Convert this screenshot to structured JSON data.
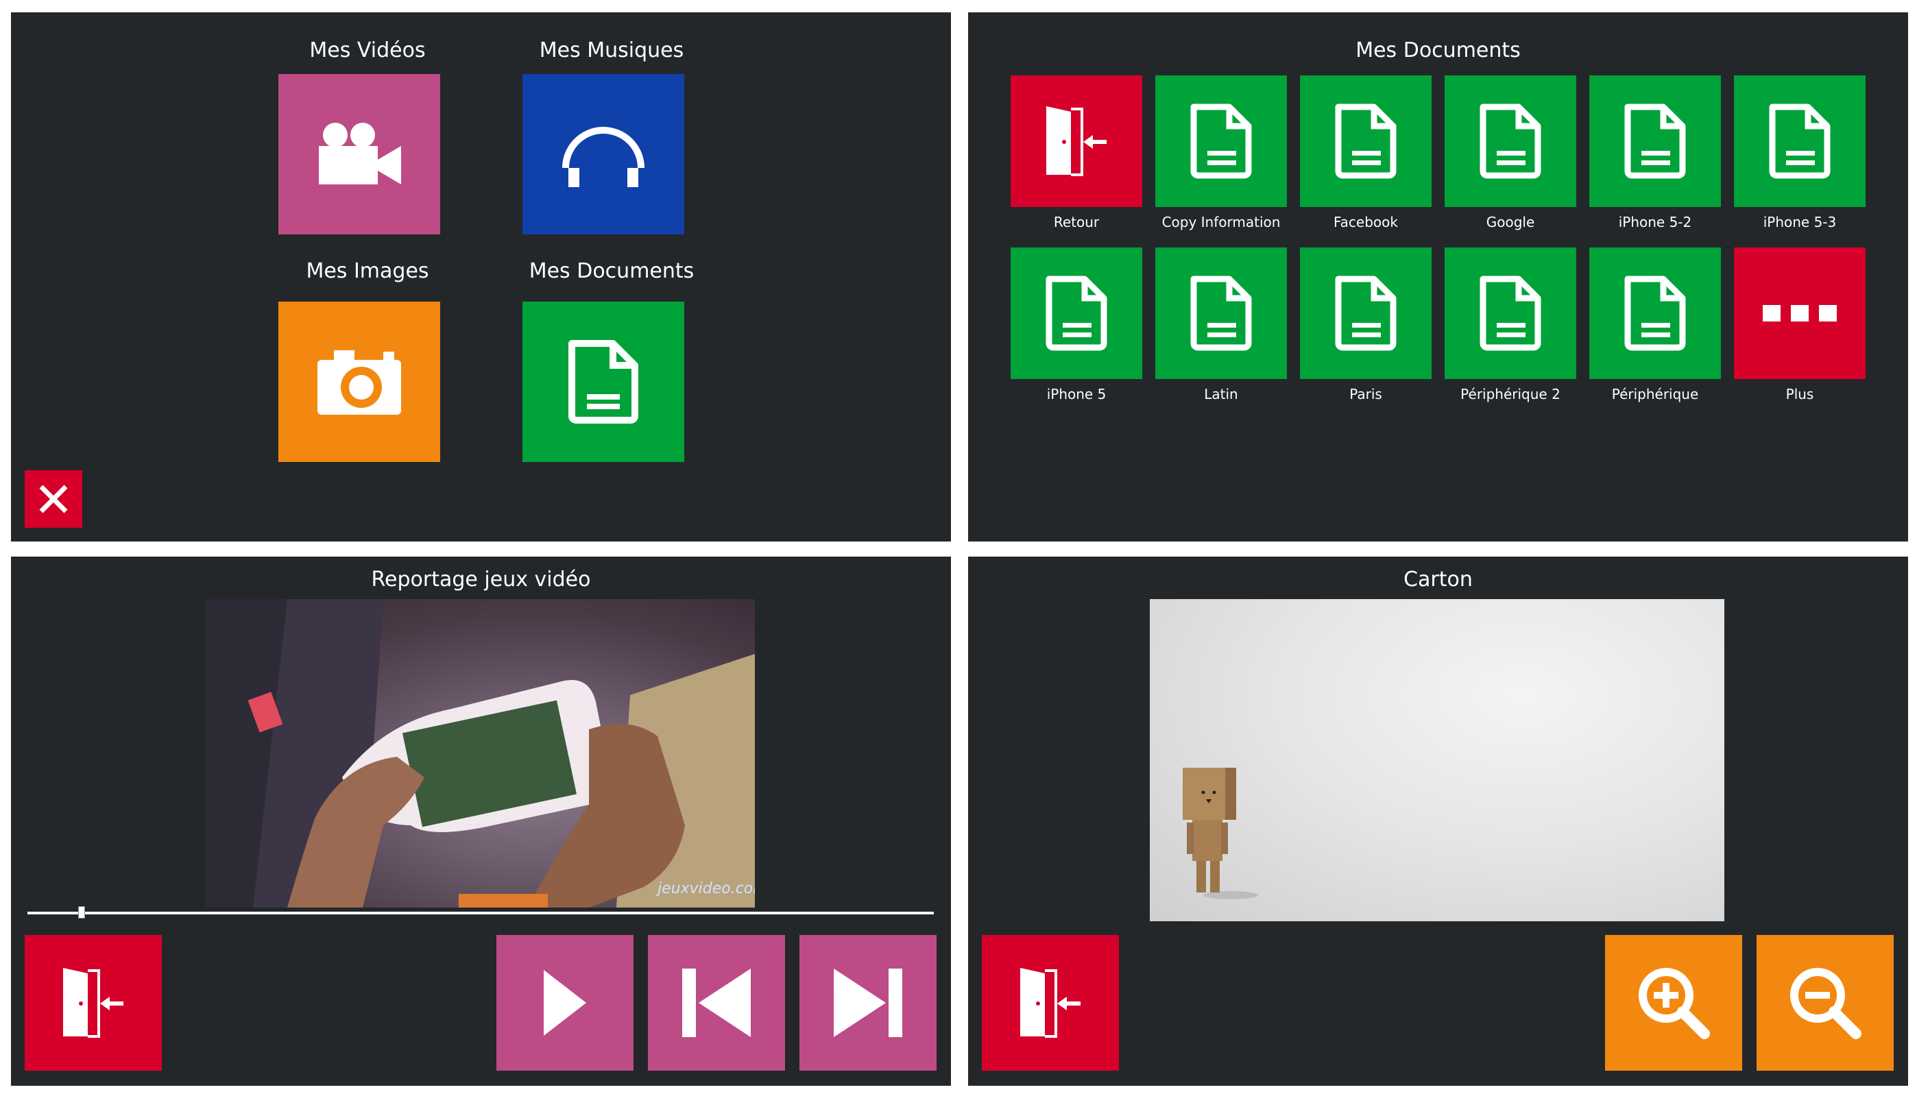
{
  "home": {
    "tiles": [
      {
        "label": "Mes Vidéos",
        "icon": "video-camera-icon",
        "color": "#bd4b86"
      },
      {
        "label": "Mes Musiques",
        "icon": "headphones-icon",
        "color": "#1040aa"
      },
      {
        "label": "Mes Images",
        "icon": "camera-icon",
        "color": "#f38810"
      },
      {
        "label": "Mes Documents",
        "icon": "document-icon",
        "color": "#00a23a"
      }
    ],
    "close_icon": "close-icon"
  },
  "documents": {
    "title": "Mes Documents",
    "items": [
      {
        "label": "Retour",
        "icon": "exit-door-icon",
        "color": "#d6002a"
      },
      {
        "label": "Copy Information",
        "icon": "document-icon",
        "color": "#00a23a"
      },
      {
        "label": "Facebook",
        "icon": "document-icon",
        "color": "#00a23a"
      },
      {
        "label": "Google",
        "icon": "document-icon",
        "color": "#00a23a"
      },
      {
        "label": "iPhone 5-2",
        "icon": "document-icon",
        "color": "#00a23a"
      },
      {
        "label": "iPhone 5-3",
        "icon": "document-icon",
        "color": "#00a23a"
      },
      {
        "label": "iPhone 5",
        "icon": "document-icon",
        "color": "#00a23a"
      },
      {
        "label": "Latin",
        "icon": "document-icon",
        "color": "#00a23a"
      },
      {
        "label": "Paris",
        "icon": "document-icon",
        "color": "#00a23a"
      },
      {
        "label": "Périphérique 2",
        "icon": "document-icon",
        "color": "#00a23a"
      },
      {
        "label": "Périphérique",
        "icon": "document-icon",
        "color": "#00a23a"
      },
      {
        "label": "Plus",
        "icon": "more-dots-icon",
        "color": "#d6002a"
      }
    ]
  },
  "video_player": {
    "title": "Reportage jeux vidéo",
    "watermark": "jeuxvideo.com",
    "progress": 0.06,
    "controls": [
      {
        "name": "exit",
        "icon": "exit-door-icon",
        "color": "#d6002a"
      },
      {
        "name": "play",
        "icon": "play-icon",
        "color": "#bd4b86"
      },
      {
        "name": "previous",
        "icon": "skip-previous-icon",
        "color": "#bd4b86"
      },
      {
        "name": "next",
        "icon": "skip-next-icon",
        "color": "#bd4b86"
      }
    ]
  },
  "image_viewer": {
    "title": "Carton",
    "controls": [
      {
        "name": "exit",
        "icon": "exit-door-icon",
        "color": "#d6002a"
      },
      {
        "name": "zoom-in",
        "icon": "zoom-in-icon",
        "color": "#f38810"
      },
      {
        "name": "zoom-out",
        "icon": "zoom-out-icon",
        "color": "#f38810"
      }
    ]
  }
}
